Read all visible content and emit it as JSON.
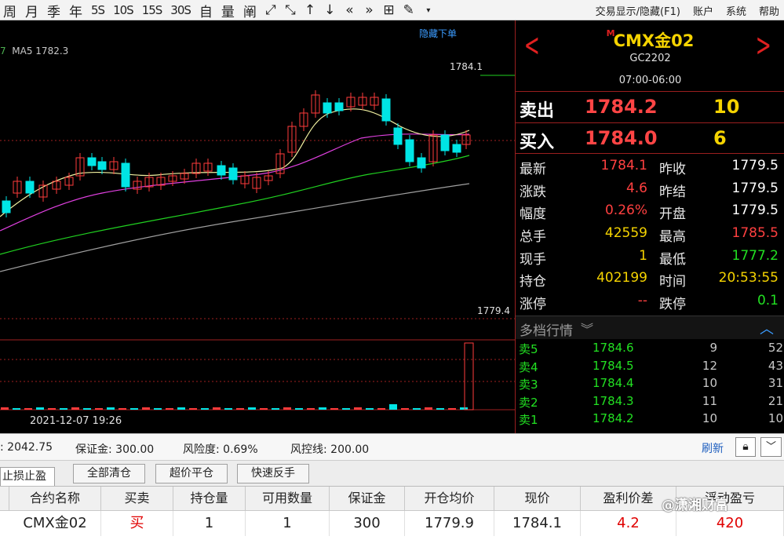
{
  "toolbar": {
    "periods": [
      "周",
      "月",
      "季",
      "年",
      "5S",
      "10S",
      "15S",
      "30S",
      "自",
      "量",
      "阐"
    ],
    "menu": {
      "trade_toggle": "交易显示/隐藏(F1)",
      "account": "账户",
      "system": "系统",
      "help": "帮助"
    }
  },
  "chart": {
    "ma_legend_prev": "7",
    "ma_legend": "MA5 1782.3",
    "hide_orders": "隐藏下单",
    "price_high_label": "1784.1",
    "price_low_label": "1779.4",
    "cursor_date": "2021-12-07 19:26",
    "colors": {
      "up": "#ff3b3b",
      "down": "#00e5e5",
      "ma5": "#f0f0a0",
      "ma10": "#e040e0",
      "ma20": "#20d020",
      "ma60": "#a0a0a0"
    }
  },
  "quote": {
    "badge": "M",
    "title": "CMX金02",
    "code": "GC2202",
    "session": "07:00-06:00",
    "ask_label": "卖出",
    "ask_price": "1784.2",
    "ask_qty": "10",
    "bid_label": "买入",
    "bid_price": "1784.0",
    "bid_qty": "6",
    "rows": [
      {
        "l1": "最新",
        "v1": "1784.1",
        "l2": "昨收",
        "v2": "1779.5"
      },
      {
        "l1": "涨跌",
        "v1": "4.6",
        "l2": "昨结",
        "v2": "1779.5"
      },
      {
        "l1": "幅度",
        "v1": "0.26%",
        "l2": "开盘",
        "v2": "1779.5"
      },
      {
        "l1": "总手",
        "v1": "42559",
        "l2": "最高",
        "v2": "1785.5"
      },
      {
        "l1": "现手",
        "v1": "1",
        "l2": "最低",
        "v2": "1777.2"
      },
      {
        "l1": "持仓",
        "v1": "402199",
        "l2": "时间",
        "v2": "20:53:55"
      },
      {
        "l1": "涨停",
        "v1": "--",
        "l2": "跌停",
        "v2": "0.1"
      }
    ],
    "depth_title": "多档行情",
    "depth": [
      {
        "label": "卖5",
        "price": "1784.6",
        "qty": "9",
        "total": "52"
      },
      {
        "label": "卖4",
        "price": "1784.5",
        "qty": "12",
        "total": "43"
      },
      {
        "label": "卖3",
        "price": "1784.4",
        "qty": "10",
        "total": "31"
      },
      {
        "label": "卖2",
        "price": "1784.3",
        "qty": "11",
        "total": "21"
      },
      {
        "label": "卖1",
        "price": "1784.2",
        "qty": "10",
        "total": "10"
      }
    ]
  },
  "account": {
    "equity": ": 2042.75",
    "margin": "保证金: 300.00",
    "risk": "风险度: 0.69%",
    "risk_line": "风控线: 200.00",
    "refresh": "刷新"
  },
  "actions": {
    "tab": "止损止盈",
    "close_all": "全部清仓",
    "super_close": "超价平仓",
    "reverse": "快速反手"
  },
  "positions": {
    "headers": [
      "合约名称",
      "买卖",
      "持仓量",
      "可用数量",
      "保证金",
      "开仓均价",
      "现价",
      "盈利价差",
      "浮动盈亏"
    ],
    "row": [
      "CMX金02",
      "买",
      "1",
      "1",
      "300",
      "1779.9",
      "1784.1",
      "4.2",
      "420"
    ],
    "watermark": "@潇湘财富"
  }
}
